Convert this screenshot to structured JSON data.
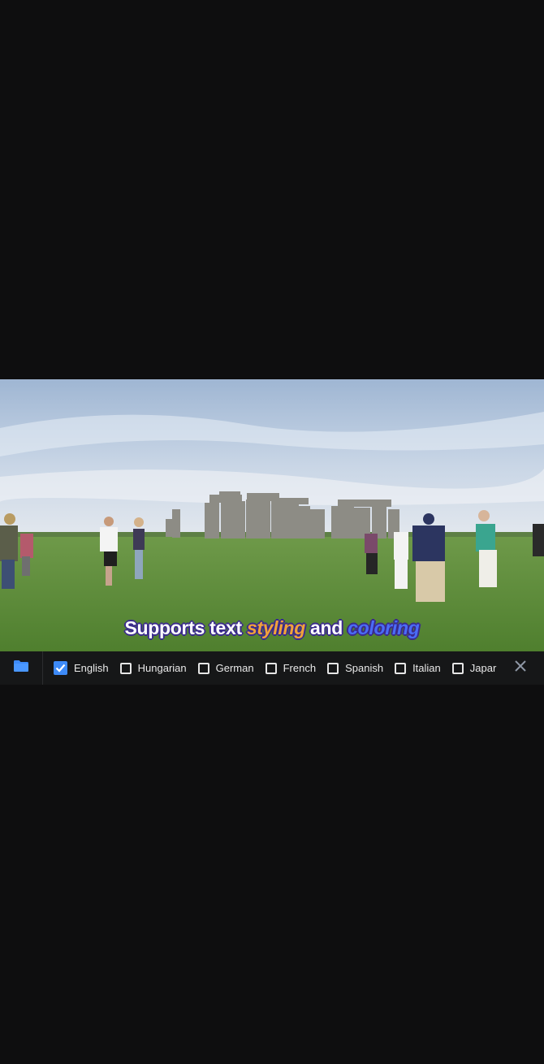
{
  "video": {
    "subtitle": {
      "part1": "Supports text ",
      "part2": "styling",
      "part3": " and ",
      "part4": "coloring",
      "color_part2": "#f0a23a",
      "color_part4": "#4a6cf7"
    }
  },
  "toolbar": {
    "folder_icon": "folder-icon",
    "close_icon": "close-icon",
    "accent_color": "#3d8af7",
    "languages": [
      {
        "label": "English",
        "checked": true
      },
      {
        "label": "Hungarian",
        "checked": false
      },
      {
        "label": "German",
        "checked": false
      },
      {
        "label": "French",
        "checked": false
      },
      {
        "label": "Spanish",
        "checked": false
      },
      {
        "label": "Italian",
        "checked": false
      },
      {
        "label": "Japar",
        "checked": false
      }
    ]
  }
}
